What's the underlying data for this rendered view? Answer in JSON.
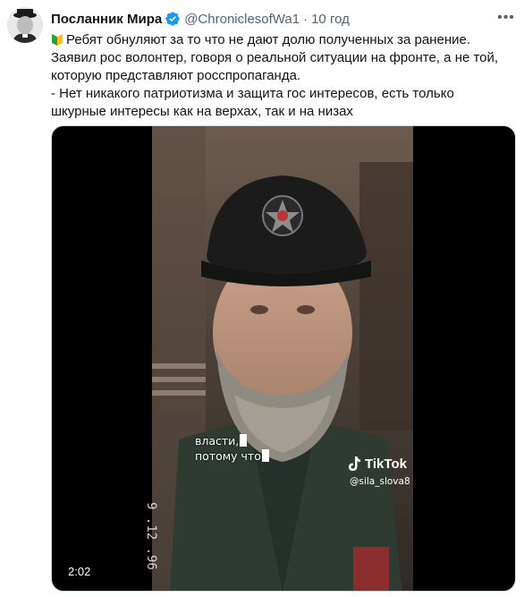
{
  "tweet": {
    "author_name": "Посланник Мира",
    "handle": "@ChroniclesofWa1",
    "separator": "·",
    "time": "10 год",
    "text_lines": [
      "Ребят обнуляют  за то что не дают долю полученных за ранение.",
      "Заявил рос волонтер, говоря о реальной ситуации на фронте, а не той,",
      "которую представляют росспропаганда.",
      "- Нет никакого патриотизма и защита гос интересов, есть только",
      "шкурные интересы как на верхах, так и на низах"
    ]
  },
  "video": {
    "subtitle_1": "власти,",
    "subtitle_2": "потому что",
    "watermark_brand": "TikTok",
    "watermark_user": "@sila_slova8",
    "duration": "2:02",
    "date_stamp": "9 .12 .96"
  },
  "colors": {
    "verified": "#1d9bf0",
    "secondary_text": "#536471",
    "primary_text": "#0f1419"
  },
  "icons": {
    "verified": "verified-badge-icon",
    "more": "more-icon",
    "flag": "beginner-flag-icon",
    "tiktok": "tiktok-note-icon"
  }
}
